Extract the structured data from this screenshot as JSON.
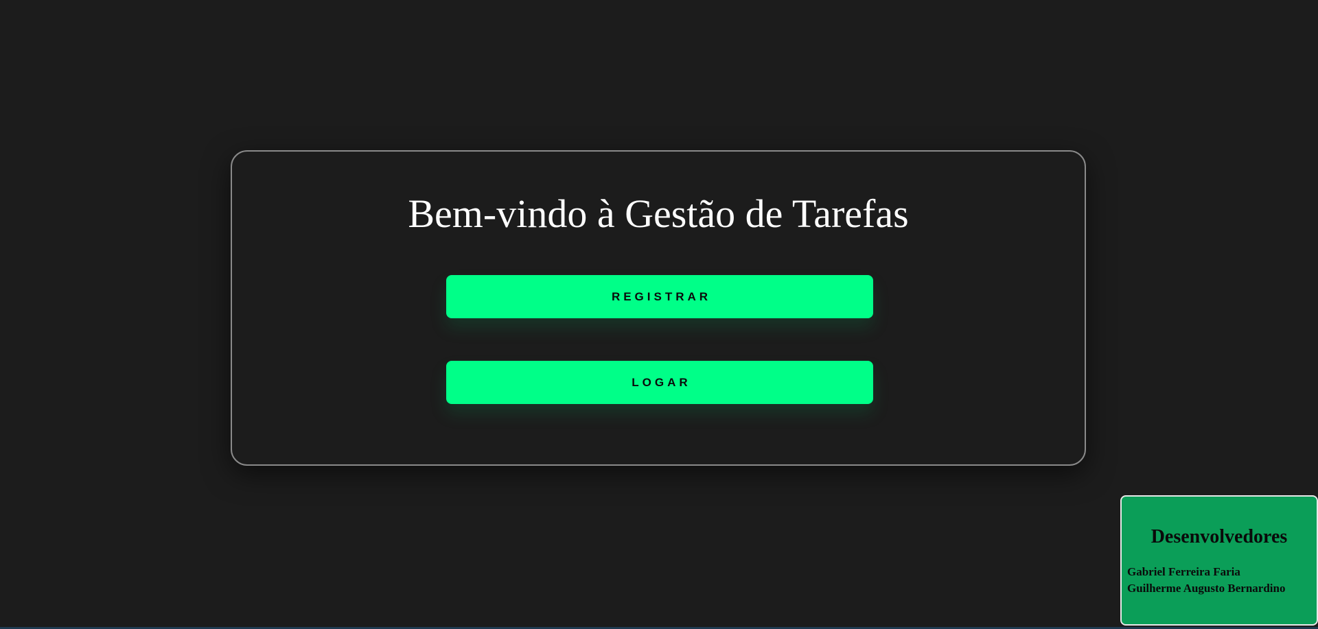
{
  "welcome": {
    "title": "Bem-vindo à Gestão de Tarefas",
    "register_label": "REGISTRAR",
    "login_label": "LOGAR"
  },
  "developers": {
    "title": "Desenvolvedores",
    "names": [
      "Gabriel Ferreira Faria",
      "Guilherme Augusto Bernardino"
    ]
  },
  "colors": {
    "background": "#1c1c1c",
    "accent": "#00ff88",
    "panel": "#0b9e58"
  }
}
